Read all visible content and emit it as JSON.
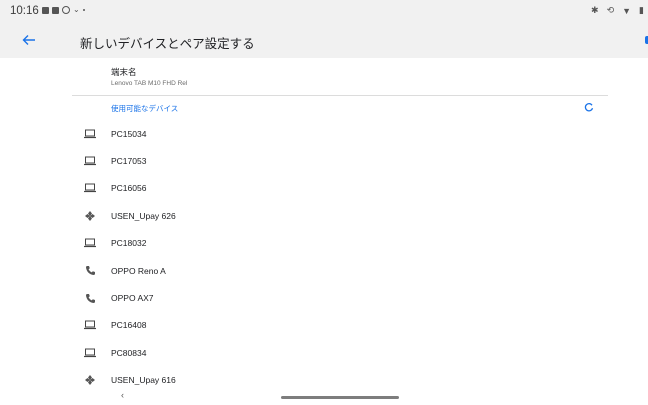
{
  "status_bar": {
    "time": "10:16",
    "left_icons": [
      "image-icon",
      "news-icon",
      "location-icon",
      "chevron-down-icon",
      "dot-icon"
    ],
    "right_icons": [
      "bluetooth-icon",
      "sync-icon",
      "wifi-icon",
      "battery-icon"
    ]
  },
  "app_bar": {
    "back_icon": "arrow-left-icon",
    "title": "新しいデバイスとペア設定する",
    "accent_color": "#1a73e8"
  },
  "device_name": {
    "label": "端末名",
    "value": "Lenovo TAB M10 FHD Rel"
  },
  "available_devices": {
    "header": "使用可能なデバイス",
    "scanning_icon": "refresh-spinner-icon",
    "items": [
      {
        "name": "PC15034",
        "icon": "laptop-icon"
      },
      {
        "name": "PC17053",
        "icon": "laptop-icon"
      },
      {
        "name": "PC16056",
        "icon": "laptop-icon"
      },
      {
        "name": "USEN_Upay 626",
        "icon": "bluetooth-generic-icon"
      },
      {
        "name": "PC18032",
        "icon": "laptop-icon"
      },
      {
        "name": "OPPO Reno A",
        "icon": "phone-icon"
      },
      {
        "name": "OPPO AX7",
        "icon": "phone-icon"
      },
      {
        "name": "PC16408",
        "icon": "laptop-icon"
      },
      {
        "name": "PC80834",
        "icon": "laptop-icon"
      },
      {
        "name": "USEN_Upay 616",
        "icon": "bluetooth-generic-icon"
      }
    ]
  },
  "nav_bar": {
    "back_glyph": "‹"
  }
}
